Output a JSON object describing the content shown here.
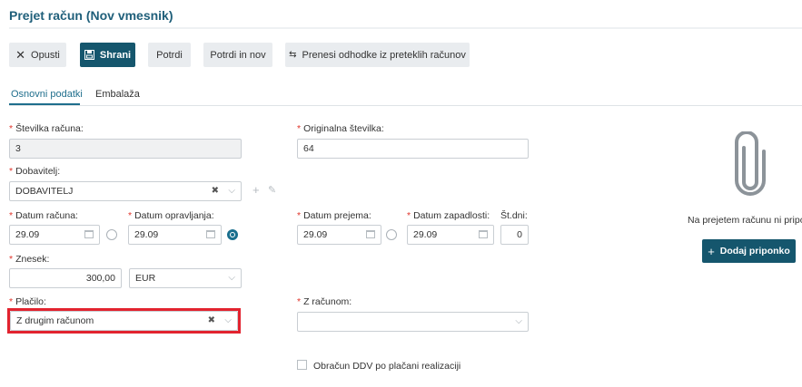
{
  "header": {
    "title": "Prejet račun (Nov vmesnik)"
  },
  "toolbar": {
    "discard": "Opusti",
    "save": "Shrani",
    "confirm": "Potrdi",
    "confirm_new": "Potrdi in nov",
    "transfer": "Prenesi odhodke iz preteklih računov"
  },
  "tabs": [
    {
      "label": "Osnovni podatki"
    },
    {
      "label": "Embalaža"
    }
  ],
  "form": {
    "invoice_number": {
      "label": "Številka računa:",
      "value": "3"
    },
    "original_number": {
      "label": "Originalna številka:",
      "value": "64"
    },
    "supplier": {
      "label": "Dobavitelj:",
      "value": "DOBAVITELJ"
    },
    "invoice_date": {
      "label": "Datum računa:",
      "value": "29.09"
    },
    "service_date": {
      "label": "Datum opravljanja:",
      "value": "29.09"
    },
    "receipt_date": {
      "label": "Datum prejema:",
      "value": "29.09"
    },
    "due_date": {
      "label": "Datum zapadlosti:",
      "value": "29.09"
    },
    "days": {
      "label": "Št.dni:",
      "value": "0"
    },
    "amount": {
      "label": "Znesek:",
      "value": "300,00",
      "currency": "EUR"
    },
    "payment": {
      "label": "Plačilo:",
      "value": "Z drugim računom"
    },
    "with_invoice": {
      "label": "Z računom:",
      "value": ""
    },
    "vat_checkbox": {
      "label": "Obračun DDV po plačani realizaciji"
    }
  },
  "attachments": {
    "empty_text": "Na prejetem računu ni priponk",
    "add_button": "Dodaj priponko"
  },
  "colors": {
    "accent": "#15566d",
    "required": "#e0352b",
    "highlight": "#e2232f"
  }
}
